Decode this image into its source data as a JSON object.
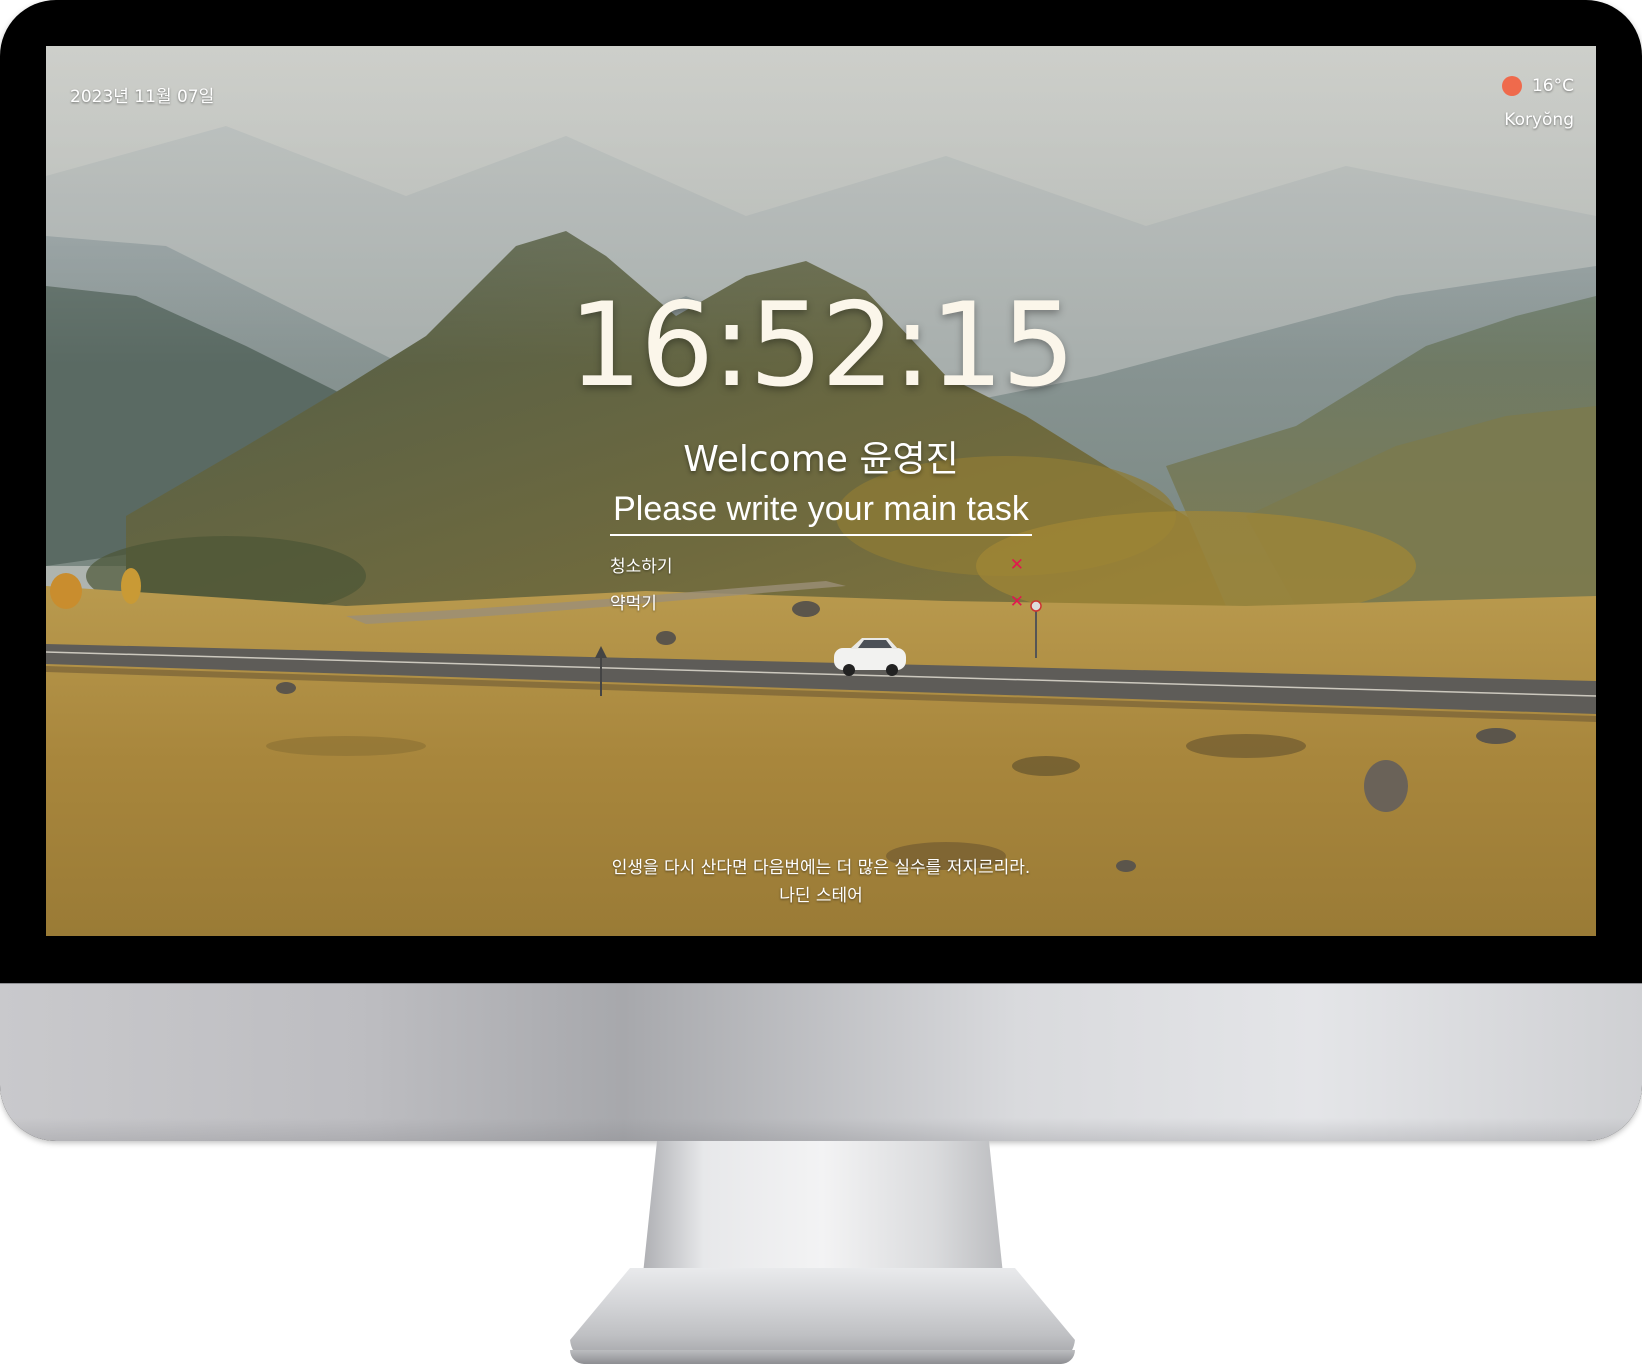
{
  "header": {
    "date": "2023년 11월 07일"
  },
  "weather": {
    "temperature": "16°C",
    "city": "Koryŏng",
    "icon": "weather-dot-icon",
    "icon_color": "#ef6a4c"
  },
  "clock": {
    "time": "16:52:15"
  },
  "greeting": {
    "text": "Welcome 윤영진"
  },
  "task": {
    "placeholder": "Please write your main task",
    "value": ""
  },
  "todos": [
    {
      "text": "청소하기",
      "delete_label": "✕"
    },
    {
      "text": "약먹기",
      "delete_label": "✕"
    }
  ],
  "quote": {
    "text": "인생을 다시 산다면 다음번에는 더 많은 실수를 저지르리라.",
    "author": "나딘 스테어"
  },
  "colors": {
    "delete_accent": "#e2174f",
    "clock_text": "#fbf6ea"
  }
}
